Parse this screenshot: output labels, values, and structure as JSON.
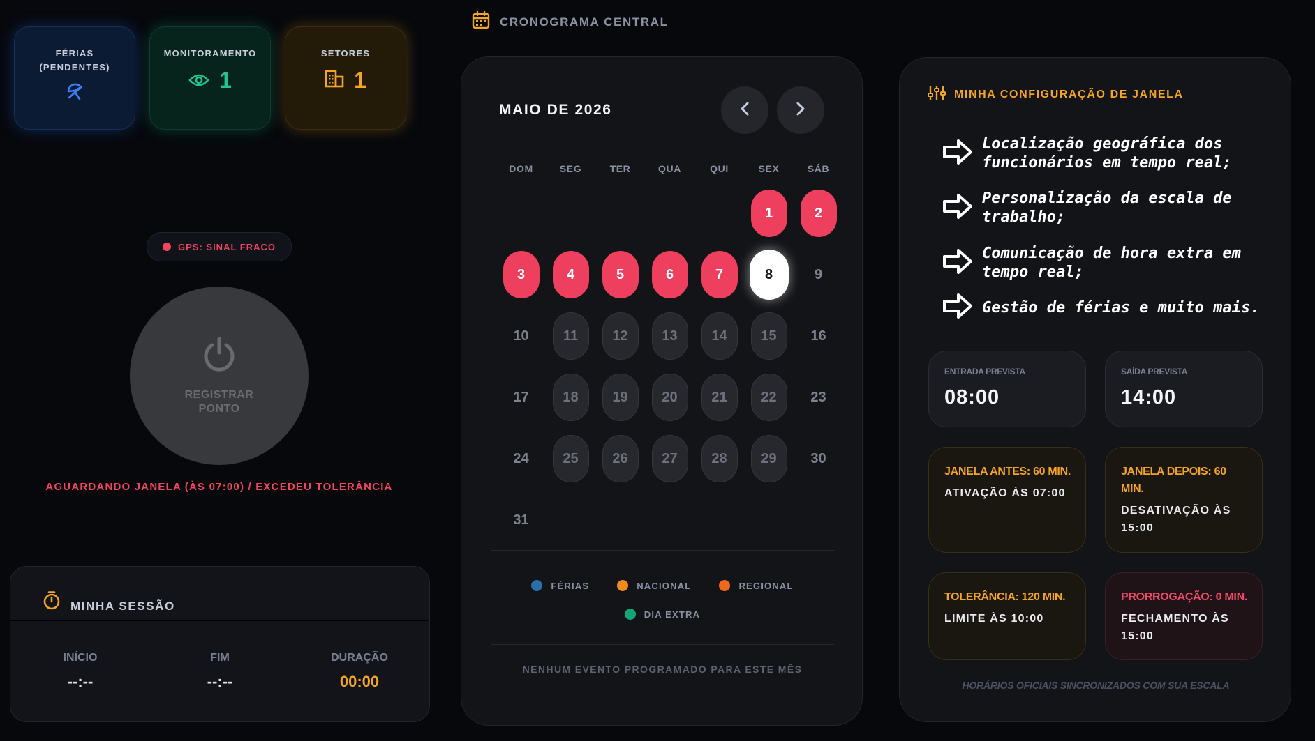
{
  "stats": {
    "ferias": {
      "label_line1": "FÉRIAS",
      "label_line2": "(PENDENTES)",
      "icon": "umbrella-icon",
      "color": "#3b82f6"
    },
    "monitoramento": {
      "label": "MONITORAMENTO",
      "value": "1",
      "icon": "eye-icon",
      "color": "#22c38e"
    },
    "setores": {
      "label": "SETORES",
      "value": "1",
      "icon": "building-icon",
      "color": "#f5a524"
    }
  },
  "gps": {
    "text": "GPS: SINAL FRACO",
    "color": "#f0455f"
  },
  "register": {
    "line1": "REGISTRAR",
    "line2": "PONTO",
    "icon": "power-icon"
  },
  "status_message": "AGUARDANDO JANELA (ÀS 07:00) / EXCEDEU TOLERÂNCIA",
  "session": {
    "title": "MINHA SESSÃO",
    "icon": "stopwatch-icon",
    "start_label": "INÍCIO",
    "start_value": "--:--",
    "end_label": "FIM",
    "end_value": "--:--",
    "duration_label": "DURAÇÃO",
    "duration_value": "00:00"
  },
  "schedule": {
    "section_title": "CRONOGRAMA CENTRAL",
    "month": "MAIO DE 2026",
    "weekdays": [
      "DOM",
      "SEG",
      "TER",
      "QUA",
      "QUI",
      "SEX",
      "SÁB"
    ],
    "days": [
      {
        "n": "1",
        "style": "red"
      },
      {
        "n": "2",
        "style": "red"
      },
      {
        "n": "3",
        "style": "red"
      },
      {
        "n": "4",
        "style": "red"
      },
      {
        "n": "5",
        "style": "red"
      },
      {
        "n": "6",
        "style": "red"
      },
      {
        "n": "7",
        "style": "red"
      },
      {
        "n": "8",
        "style": "today"
      },
      {
        "n": "9",
        "style": "plain"
      },
      {
        "n": "10",
        "style": "plain"
      },
      {
        "n": "11",
        "style": "boxed"
      },
      {
        "n": "12",
        "style": "boxed"
      },
      {
        "n": "13",
        "style": "boxed"
      },
      {
        "n": "14",
        "style": "boxed"
      },
      {
        "n": "15",
        "style": "boxed"
      },
      {
        "n": "16",
        "style": "plain"
      },
      {
        "n": "17",
        "style": "plain"
      },
      {
        "n": "18",
        "style": "boxed"
      },
      {
        "n": "19",
        "style": "boxed"
      },
      {
        "n": "20",
        "style": "boxed"
      },
      {
        "n": "21",
        "style": "boxed"
      },
      {
        "n": "22",
        "style": "boxed"
      },
      {
        "n": "23",
        "style": "plain"
      },
      {
        "n": "24",
        "style": "plain"
      },
      {
        "n": "25",
        "style": "boxed"
      },
      {
        "n": "26",
        "style": "boxed"
      },
      {
        "n": "27",
        "style": "boxed"
      },
      {
        "n": "28",
        "style": "boxed"
      },
      {
        "n": "29",
        "style": "boxed"
      },
      {
        "n": "30",
        "style": "plain"
      },
      {
        "n": "31",
        "style": "plain"
      }
    ],
    "first_weekday": 5,
    "legend": [
      {
        "label": "FÉRIAS",
        "color": "#2a6fa8"
      },
      {
        "label": "NACIONAL",
        "color": "#f08a1c"
      },
      {
        "label": "REGIONAL",
        "color": "#f0681c"
      },
      {
        "label": "DIA EXTRA",
        "color": "#13a574"
      }
    ],
    "empty_message": "NENHUM EVENTO PROGRAMADO PARA ESTE MÊS"
  },
  "config": {
    "title": "MINHA CONFIGURAÇÃO DE JANELA",
    "icon": "sliders-icon",
    "features": [
      "Localização geográfica dos funcionários em tempo real;",
      "Personalização da escala de trabalho;",
      "Comunicação de hora extra em tempo real;",
      "Gestão de férias e muito mais."
    ],
    "entrada_label": "ENTRADA PREVISTA",
    "entrada_value": "08:00",
    "saida_label": "SAÍDA PREVISTA",
    "saida_value": "14:00",
    "janela_antes_label": "JANELA ANTES: 60 MIN.",
    "janela_antes_value": "ATIVAÇÃO ÀS 07:00",
    "janela_depois_label": "JANELA DEPOIS: 60 MIN.",
    "janela_depois_value": "DESATIVAÇÃO ÀS 15:00",
    "tolerancia_label": "TOLERÂNCIA: 120 MIN.",
    "tolerancia_value": "LIMITE ÀS 10:00",
    "prorrogacao_label": "PRORROGAÇÃO: 0 MIN.",
    "prorrogacao_value": "FECHAMENTO ÀS 15:00",
    "footer": "HORÁRIOS OFICIAIS SINCRONIZADOS COM SUA ESCALA"
  }
}
